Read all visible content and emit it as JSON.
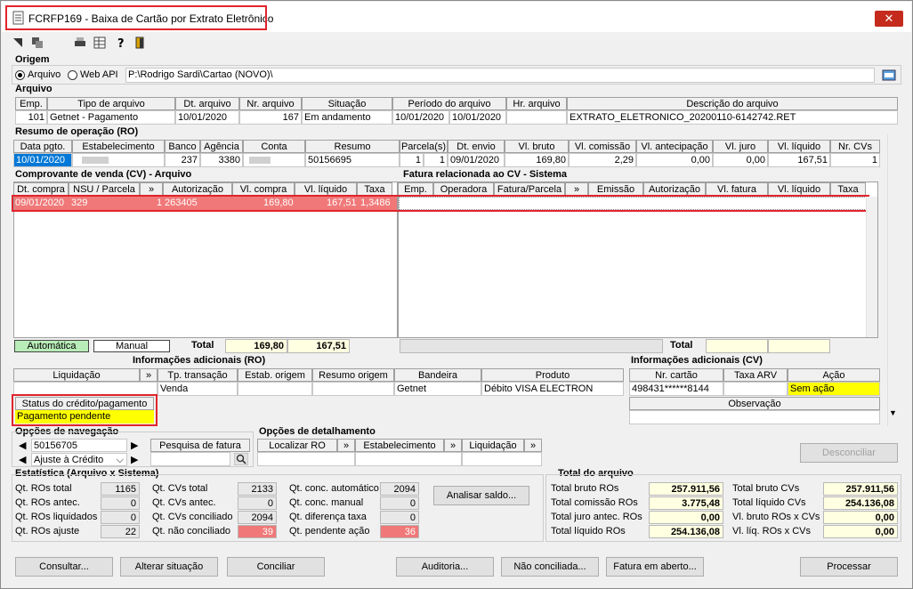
{
  "window": {
    "title": "FCRFP169 - Baixa de Cartão por Extrato Eletrônico",
    "close": "✕"
  },
  "origem": {
    "section": "Origem",
    "opt1": "Arquivo",
    "opt2": "Web API",
    "path": "P:\\Rodrigo Sardi\\Cartao (NOVO)\\"
  },
  "arquivo": {
    "section": "Arquivo",
    "headers": [
      "Emp.",
      "Tipo de arquivo",
      "Dt. arquivo",
      "Nr. arquivo",
      "Situação",
      "Período do arquivo",
      "Hr. arquivo",
      "Descrição do arquivo"
    ],
    "row": {
      "emp": "101",
      "tipo": "Getnet - Pagamento",
      "dt": "10/01/2020",
      "nr": "167",
      "sit": "Em andamento",
      "p1": "10/01/2020",
      "p2": "10/01/2020",
      "hr": "",
      "desc": "EXTRATO_ELETRONICO_20200110-6142742.RET"
    }
  },
  "ro": {
    "section": "Resumo de operação (RO)",
    "headers": [
      "Data pgto.",
      "Estabelecimento",
      "Banco",
      "Agência",
      "Conta",
      "Resumo",
      "Parcela(s)",
      "Dt. envio",
      "Vl. bruto",
      "Vl. comissão",
      "Vl. antecipação",
      "Vl. juro",
      "Vl. líquido",
      "Nr. CVs"
    ],
    "row": {
      "data": "10/01/2020",
      "estab": "",
      "banco": "237",
      "agencia": "3380",
      "conta": "",
      "resumo": "50156695",
      "p1": "1",
      "p2": "1",
      "envio": "09/01/2020",
      "bruto": "169,80",
      "comissao": "2,29",
      "antecip": "0,00",
      "juro": "0,00",
      "liquido": "167,51",
      "ncvs": "1"
    }
  },
  "cv": {
    "section": "Comprovante de venda (CV) - Arquivo",
    "headers": [
      "Dt. compra",
      "NSU / Parcela",
      "»",
      "Autorização",
      "Vl. compra",
      "Vl. líquido",
      "Taxa"
    ],
    "row": {
      "dt": "09/01/2020",
      "nsu": "329",
      "parc": "1",
      "aut": "263405",
      "compra": "169,80",
      "liquido": "167,51",
      "taxa": "1,3486"
    },
    "legend_auto": "Automática",
    "legend_manual": "Manual",
    "total_label": "Total",
    "total_compra": "169,80",
    "total_liquido": "167,51"
  },
  "fatura": {
    "section": "Fatura relacionada ao CV - Sistema",
    "headers": [
      "Emp.",
      "Operadora",
      "Fatura/Parcela",
      "»",
      "Emissão",
      "Autorização",
      "Vl. fatura",
      "Vl. líquido",
      "Taxa"
    ],
    "total_label": "Total"
  },
  "info_ro": {
    "section": "Informações adicionais (RO)",
    "headers": [
      "Liquidação",
      "»",
      "Tp. transação",
      "Estab. origem",
      "Resumo origem",
      "Bandeira",
      "Produto"
    ],
    "row": {
      "tp": "Venda",
      "bandeira": "Getnet",
      "produto": "Débito VISA ELECTRON"
    },
    "status_label": "Status do crédito/pagamento",
    "status_value": "Pagamento pendente"
  },
  "info_cv": {
    "section": "Informações adicionais (CV)",
    "headers": [
      "Nr. cartão",
      "Taxa ARV",
      "Ação"
    ],
    "cartao": "498431******8144",
    "acao": "Sem ação",
    "obs_label": "Observação"
  },
  "nav": {
    "section": "Opções de navegação",
    "value": "50156705",
    "select": "Ajuste à Crédito",
    "pesquisa": "Pesquisa de fatura"
  },
  "detalhe": {
    "section": "Opções de detalhamento",
    "h1": "Localizar RO",
    "h2": "»",
    "h3": "Estabelecimento",
    "h4": "»",
    "h5": "Liquidação",
    "h6": "»"
  },
  "desconciliar": "Desconciliar",
  "estat": {
    "section": "Estatística (Arquivo x Sistema)",
    "c1": [
      {
        "l": "Qt. ROs total",
        "v": "1165"
      },
      {
        "l": "Qt. ROs antec.",
        "v": "0"
      },
      {
        "l": "Qt. ROs liquidados",
        "v": "0"
      },
      {
        "l": "Qt. ROs ajuste",
        "v": "22"
      }
    ],
    "c2": [
      {
        "l": "Qt. CVs total",
        "v": "2133"
      },
      {
        "l": "Qt. CVs antec.",
        "v": "0"
      },
      {
        "l": "Qt. CVs conciliado",
        "v": "2094"
      },
      {
        "l": "Qt. não conciliado",
        "v": "39"
      }
    ],
    "c3": [
      {
        "l": "Qt. conc. automático",
        "v": "2094"
      },
      {
        "l": "Qt. conc. manual",
        "v": "0"
      },
      {
        "l": "Qt. diferença taxa",
        "v": "0"
      },
      {
        "l": "Qt. pendente ação",
        "v": "36"
      }
    ],
    "analisar": "Analisar saldo..."
  },
  "total_arq": {
    "section": "Total do arquivo",
    "left": [
      {
        "l": "Total bruto ROs",
        "v": "257.911,56"
      },
      {
        "l": "Total comissão ROs",
        "v": "3.775,48"
      },
      {
        "l": "Total juro antec. ROs",
        "v": "0,00"
      },
      {
        "l": "Total líquido ROs",
        "v": "254.136,08"
      }
    ],
    "right": [
      {
        "l": "Total bruto CVs",
        "v": "257.911,56"
      },
      {
        "l": "Total líquido CVs",
        "v": "254.136,08"
      },
      {
        "l": "Vl. bruto ROs x CVs",
        "v": "0,00"
      },
      {
        "l": "Vl. líq. ROs x CVs",
        "v": "0,00"
      }
    ]
  },
  "buttons": {
    "consultar": "Consultar...",
    "alterar": "Alterar situação",
    "conciliar": "Conciliar",
    "auditoria": "Auditoria...",
    "nao": "Não conciliada...",
    "fatura": "Fatura em aberto...",
    "processar": "Processar"
  }
}
